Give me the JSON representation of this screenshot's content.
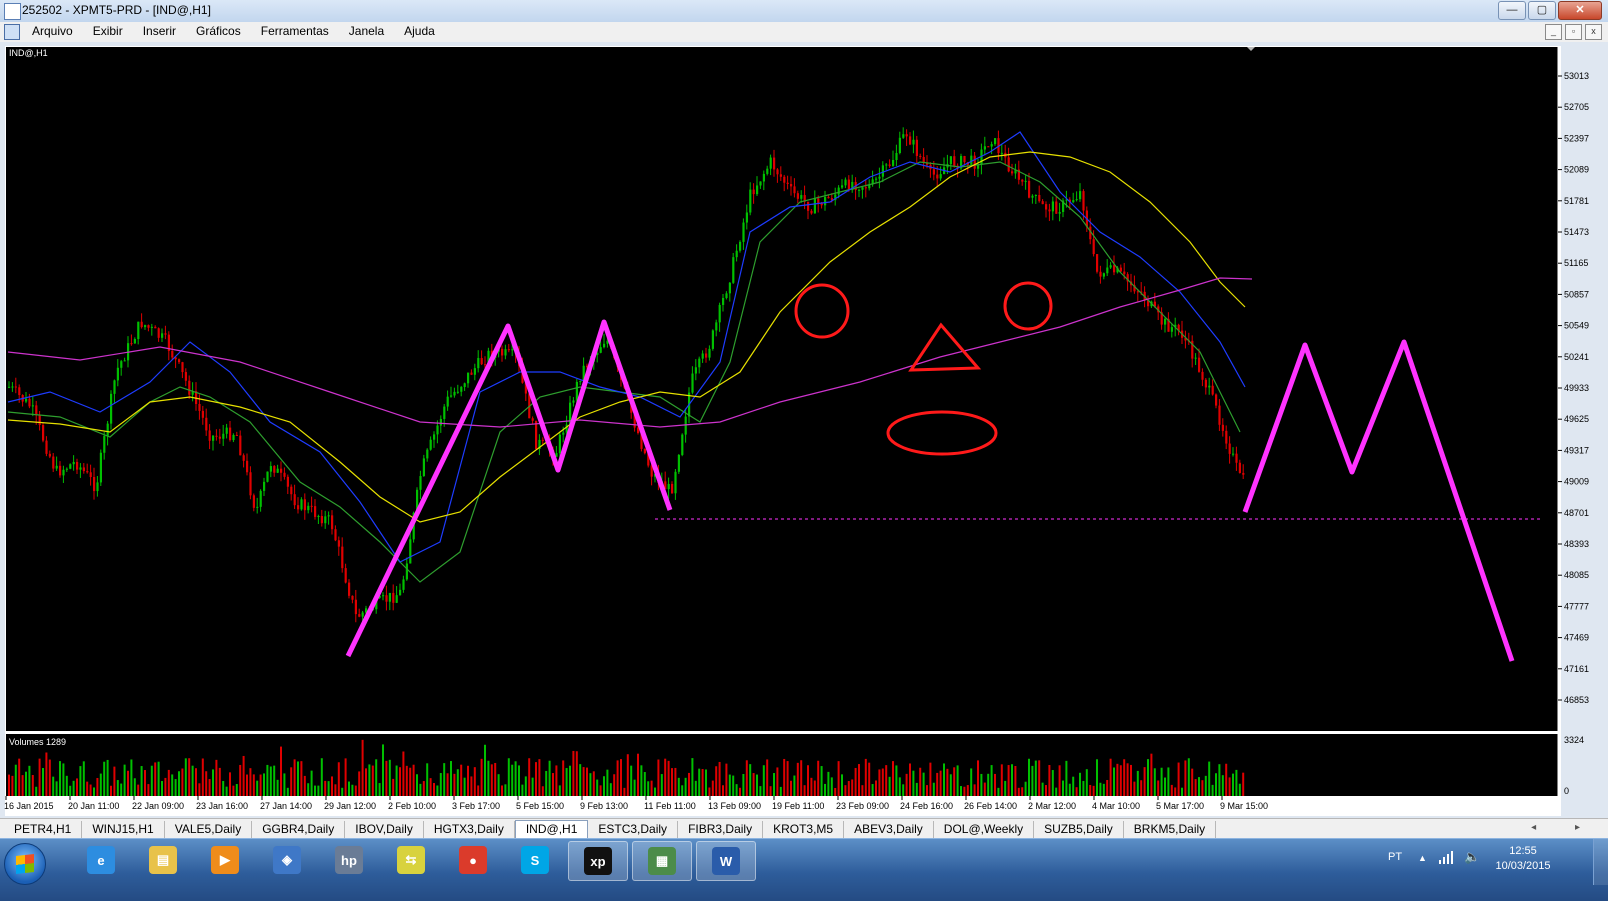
{
  "window": {
    "title": "252502 - XPMT5-PRD - [IND@,H1]",
    "controls": {
      "minimize": "—",
      "maximize": "▢",
      "close": "✕"
    }
  },
  "menu": {
    "items": [
      "Arquivo",
      "Exibir",
      "Inserir",
      "Gráficos",
      "Ferramentas",
      "Janela",
      "Ajuda"
    ],
    "mdi_controls": [
      "_",
      "▫",
      "x"
    ]
  },
  "chart": {
    "symbol_label": "IND@,H1",
    "volume_label": "Volumes 1289",
    "price_axis": [
      "53013",
      "52705",
      "52397",
      "52089",
      "51781",
      "51473",
      "51165",
      "50857",
      "50549",
      "50241",
      "49933",
      "49625",
      "49317",
      "49009",
      "48701",
      "48393",
      "48085",
      "47777",
      "47469",
      "47161",
      "46853"
    ],
    "volume_axis": [
      "3324",
      "0"
    ],
    "time_axis": [
      "16 Jan 2015",
      "20 Jan 11:00",
      "22 Jan 09:00",
      "23 Jan 16:00",
      "27 Jan 14:00",
      "29 Jan 12:00",
      "2 Feb 10:00",
      "3 Feb 17:00",
      "5 Feb 15:00",
      "9 Feb 13:00",
      "11 Feb 11:00",
      "13 Feb 09:00",
      "19 Feb 11:00",
      "23 Feb 09:00",
      "24 Feb 16:00",
      "26 Feb 14:00",
      "2 Mar 12:00",
      "4 Mar 10:00",
      "5 Mar 17:00",
      "9 Mar 15:00"
    ],
    "colors": {
      "background": "#000000",
      "bull": "#00c000",
      "bear": "#e00000",
      "ma_fast": "#2e9e2e",
      "ma_blue": "#1e3cff",
      "ma_yellow": "#e6e000",
      "ma_magenta": "#cc33cc",
      "annotation": "#ff33ff",
      "shapes": "#ff1a1a"
    }
  },
  "tabs": {
    "items": [
      "PETR4,H1",
      "WINJ15,H1",
      "VALE5,Daily",
      "GGBR4,Daily",
      "IBOV,Daily",
      "HGTX3,Daily",
      "IND@,H1",
      "ESTC3,Daily",
      "FIBR3,Daily",
      "KROT3,M5",
      "ABEV3,Daily",
      "DOL@,Weekly",
      "SUZB5,Daily",
      "BRKM5,Daily"
    ],
    "active": "IND@,H1",
    "arrows": "◂ ▸"
  },
  "taskbar": {
    "apps": [
      {
        "name": "internet-explorer-icon",
        "glyph": "e",
        "color": "#2d8de0"
      },
      {
        "name": "folder-icon",
        "glyph": "▤",
        "color": "#e8c24a"
      },
      {
        "name": "media-player-icon",
        "glyph": "▶",
        "color": "#ef8c1b"
      },
      {
        "name": "network-icon",
        "glyph": "◈",
        "color": "#3f78c7"
      },
      {
        "name": "hp-icon",
        "glyph": "hp",
        "color": "#6a7c96"
      },
      {
        "name": "sync-icon",
        "glyph": "⇆",
        "color": "#d8d23e"
      },
      {
        "name": "chrome-icon",
        "glyph": "●",
        "color": "#db3b2b"
      },
      {
        "name": "skype-icon",
        "glyph": "S",
        "color": "#00a6e6"
      },
      {
        "name": "xp-icon",
        "glyph": "xp",
        "color": "#111111"
      },
      {
        "name": "metatrader-icon",
        "glyph": "▦",
        "color": "#4c8c4a"
      },
      {
        "name": "word-icon",
        "glyph": "W",
        "color": "#2a5caa"
      }
    ],
    "lang": "PT",
    "time": "12:55",
    "date": "10/03/2015"
  }
}
